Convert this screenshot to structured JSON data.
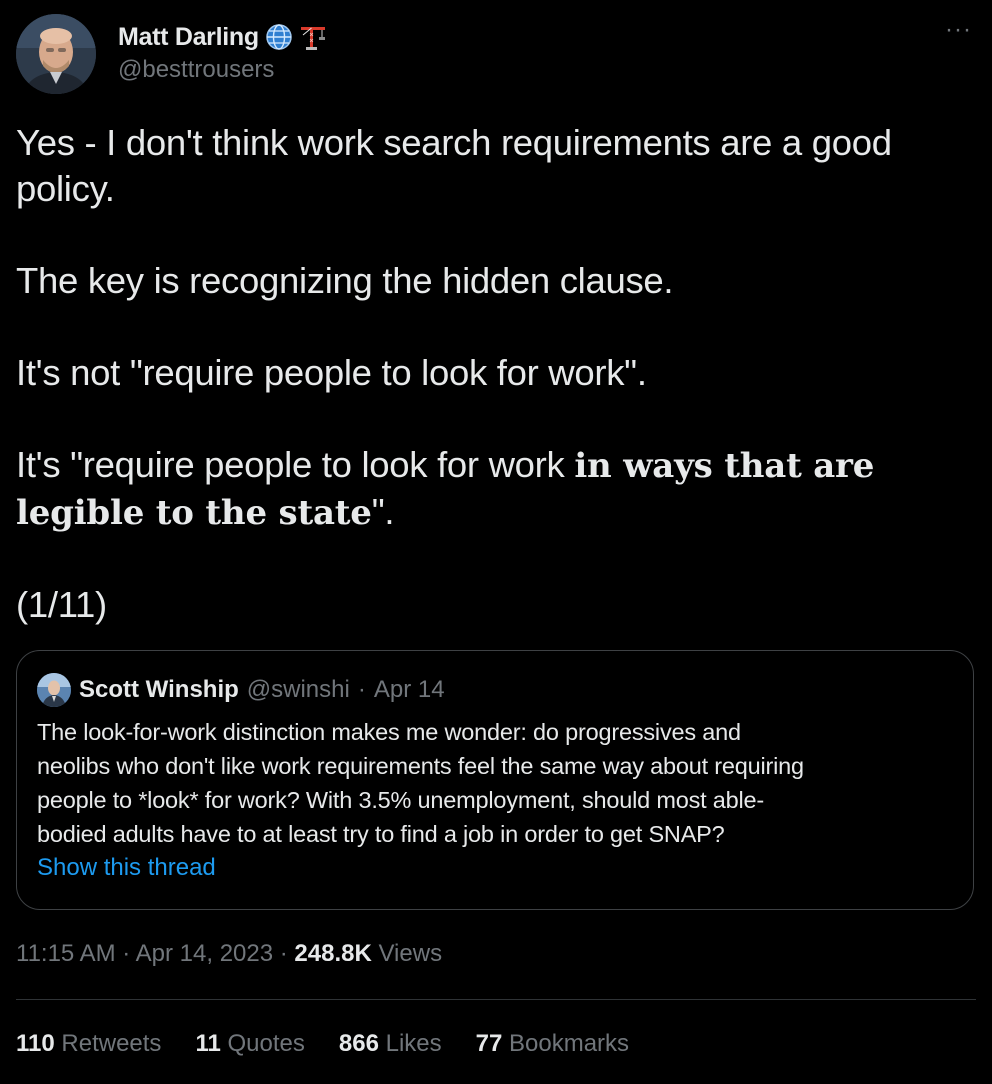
{
  "author": {
    "name": "Matt Darling",
    "handle": "@besttrousers",
    "badges": [
      "globe-emoji",
      "construction-crane-emoji"
    ],
    "more_label": "···"
  },
  "tweet": {
    "paragraphs": [
      [
        "Yes - I don't think work search requirements are a good policy."
      ],
      [
        "The key is recognizing the hidden clause."
      ],
      [
        "It's not \"require people to look for work\"."
      ],
      [
        "It's \"require people to look for work ",
        "in ways that are legible to the state",
        "\"."
      ],
      [
        "(1/11)"
      ]
    ]
  },
  "quote": {
    "name": "Scott Winship",
    "handle": "@swinshi",
    "separator": "·",
    "date": "Apr 14",
    "lines": [
      "The look-for-work distinction makes me wonder: do progressives and",
      "neolibs who don't like work requirements feel the same way about requiring",
      "people to *look* for work? With 3.5% unemployment, should most able-",
      "bodied adults have to at least try to find a job in order to get SNAP?"
    ],
    "show_thread": "Show this thread"
  },
  "meta": {
    "time": "11:15 AM",
    "dot1": "·",
    "date": "Apr 14, 2023",
    "dot2": "·",
    "views_count": "248.8K",
    "views_label": "Views"
  },
  "stats": [
    {
      "count": "110",
      "label": "Retweets"
    },
    {
      "count": "11",
      "label": "Quotes"
    },
    {
      "count": "866",
      "label": "Likes"
    },
    {
      "count": "77",
      "label": "Bookmarks"
    }
  ],
  "colors": {
    "background": "#000000",
    "text": "#e7e9ea",
    "secondary": "#71767b",
    "link": "#1d9bf0",
    "border": "#3e4144"
  }
}
